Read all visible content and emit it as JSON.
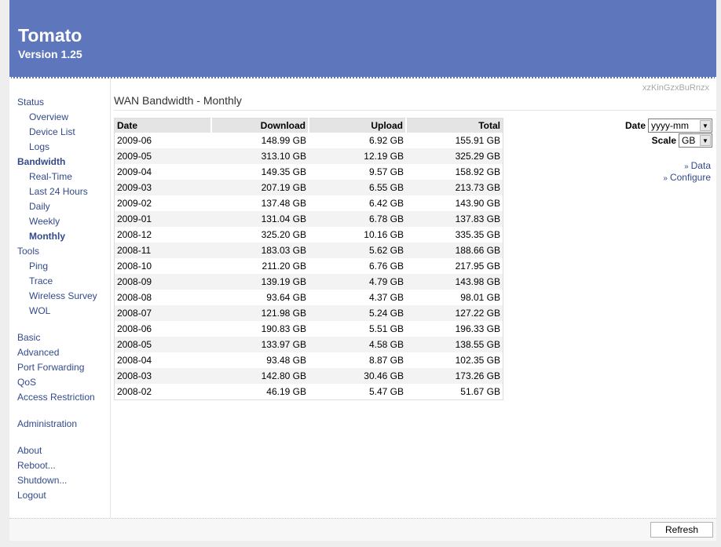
{
  "header": {
    "title": "Tomato",
    "version": "Version 1.25"
  },
  "router_name": "xzKinGzxBuRnzx",
  "page_title": "WAN Bandwidth - Monthly",
  "sidebar": {
    "status": "Status",
    "overview": "Overview",
    "device_list": "Device List",
    "logs": "Logs",
    "bandwidth": "Bandwidth",
    "realtime": "Real-Time",
    "last24": "Last 24 Hours",
    "daily": "Daily",
    "weekly": "Weekly",
    "monthly": "Monthly",
    "tools": "Tools",
    "ping": "Ping",
    "trace": "Trace",
    "wireless_survey": "Wireless Survey",
    "wol": "WOL",
    "basic": "Basic",
    "advanced": "Advanced",
    "port_forwarding": "Port Forwarding",
    "qos": "QoS",
    "access_restriction": "Access Restriction",
    "administration": "Administration",
    "about": "About",
    "reboot": "Reboot...",
    "shutdown": "Shutdown...",
    "logout": "Logout"
  },
  "table": {
    "headers": [
      "Date",
      "Download",
      "Upload",
      "Total"
    ],
    "rows": [
      [
        "2009-06",
        "148.99 GB",
        "6.92 GB",
        "155.91 GB"
      ],
      [
        "2009-05",
        "313.10 GB",
        "12.19 GB",
        "325.29 GB"
      ],
      [
        "2009-04",
        "149.35 GB",
        "9.57 GB",
        "158.92 GB"
      ],
      [
        "2009-03",
        "207.19 GB",
        "6.55 GB",
        "213.73 GB"
      ],
      [
        "2009-02",
        "137.48 GB",
        "6.42 GB",
        "143.90 GB"
      ],
      [
        "2009-01",
        "131.04 GB",
        "6.78 GB",
        "137.83 GB"
      ],
      [
        "2008-12",
        "325.20 GB",
        "10.16 GB",
        "335.35 GB"
      ],
      [
        "2008-11",
        "183.03 GB",
        "5.62 GB",
        "188.66 GB"
      ],
      [
        "2008-10",
        "211.20 GB",
        "6.76 GB",
        "217.95 GB"
      ],
      [
        "2008-09",
        "139.19 GB",
        "4.79 GB",
        "143.98 GB"
      ],
      [
        "2008-08",
        "93.64 GB",
        "4.37 GB",
        "98.01 GB"
      ],
      [
        "2008-07",
        "121.98 GB",
        "5.24 GB",
        "127.22 GB"
      ],
      [
        "2008-06",
        "190.83 GB",
        "5.51 GB",
        "196.33 GB"
      ],
      [
        "2008-05",
        "133.97 GB",
        "4.58 GB",
        "138.55 GB"
      ],
      [
        "2008-04",
        "93.48 GB",
        "8.87 GB",
        "102.35 GB"
      ],
      [
        "2008-03",
        "142.80 GB",
        "30.46 GB",
        "173.26 GB"
      ],
      [
        "2008-02",
        "46.19 GB",
        "5.47 GB",
        "51.67 GB"
      ]
    ]
  },
  "controls": {
    "date_label": "Date",
    "date_value": "yyyy-mm",
    "scale_label": "Scale",
    "scale_value": "GB",
    "data_link": "Data",
    "configure_link": "Configure",
    "link_marker": "»"
  },
  "footer": {
    "refresh_label": "Refresh"
  },
  "colors": {
    "header_bg": "#5e77bc",
    "link": "#334a8a"
  }
}
